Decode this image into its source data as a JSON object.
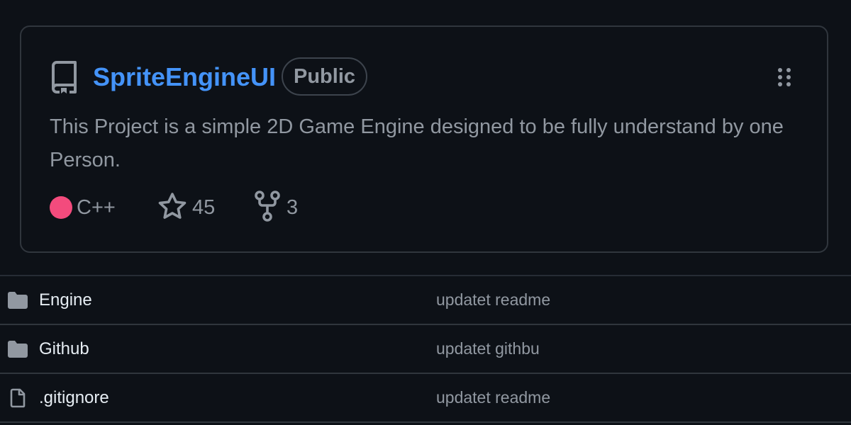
{
  "repo": {
    "name": "SpriteEngineUI",
    "visibility": "Public",
    "description": "This Project is a simple 2D Game Engine designed to be fully understand by one Person.",
    "language": "C++",
    "language_color": "#f34b7d",
    "stars": "45",
    "forks": "3",
    "link_color": "#4493f8"
  },
  "icons": {
    "repo": "repo-icon",
    "grip": "grip-vertical-icon",
    "star": "star-icon",
    "fork": "fork-icon",
    "folder": "folder-icon",
    "file": "file-icon"
  },
  "files": [
    {
      "name": "Engine",
      "type": "folder",
      "message": "updatet readme"
    },
    {
      "name": "Github",
      "type": "folder",
      "message": "updatet githbu"
    },
    {
      "name": ".gitignore",
      "type": "file",
      "message": "updatet readme"
    }
  ]
}
